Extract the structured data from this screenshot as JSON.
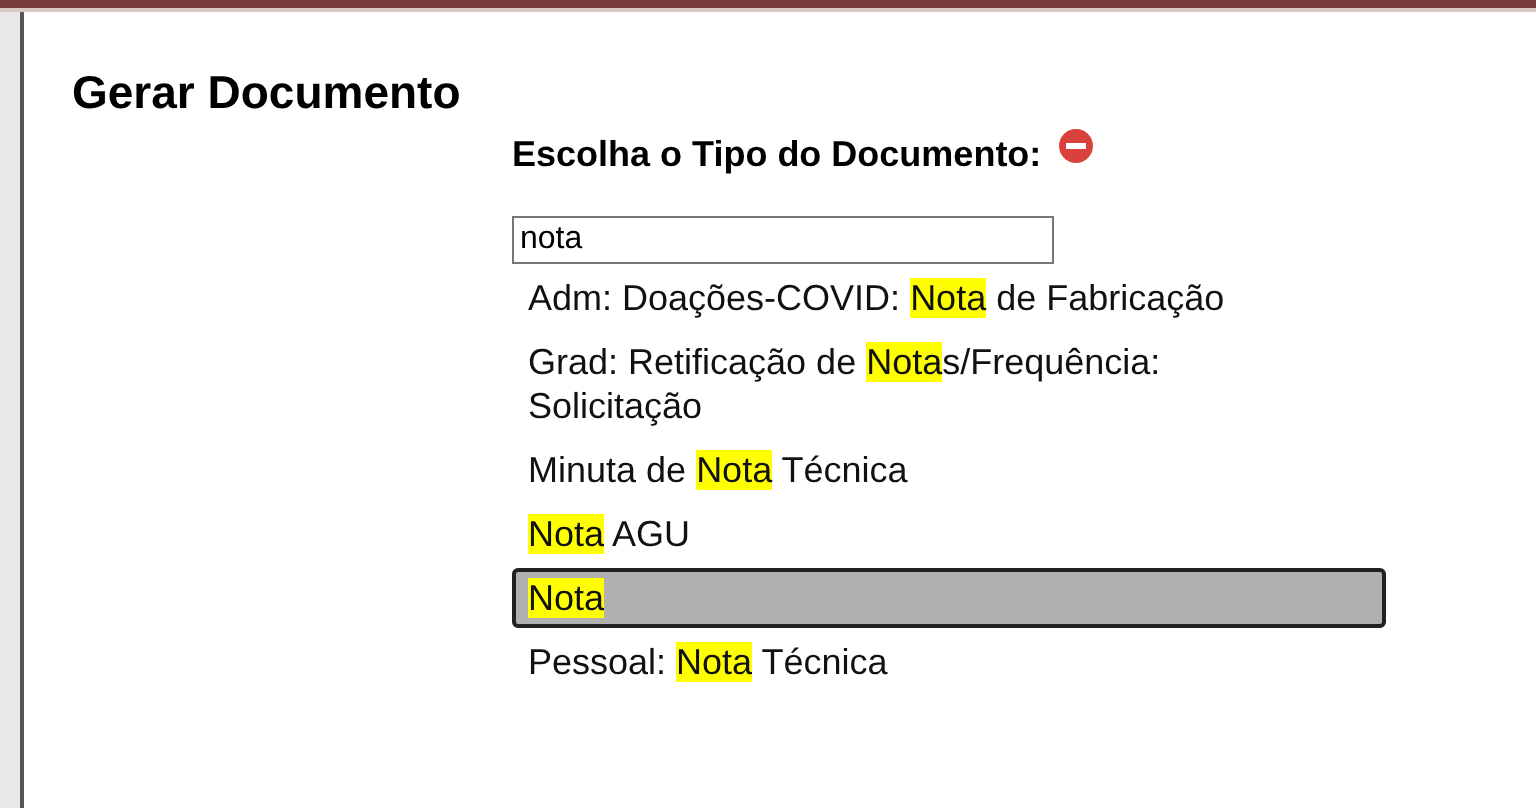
{
  "title": "Gerar Documento",
  "heading": "Escolha o Tipo do Documento:",
  "search": {
    "value": "nota"
  },
  "items": [
    {
      "selected": false,
      "parts": [
        {
          "text": "Adm: Doações-COVID: ",
          "highlighted": false
        },
        {
          "text": "Nota",
          "highlighted": true
        },
        {
          "text": " de Fabricação",
          "highlighted": false
        }
      ]
    },
    {
      "selected": false,
      "parts": [
        {
          "text": "Grad: Retificação de ",
          "highlighted": false
        },
        {
          "text": "Nota",
          "highlighted": true
        },
        {
          "text": "s/Frequência: Solicitação",
          "highlighted": false
        }
      ]
    },
    {
      "selected": false,
      "parts": [
        {
          "text": "Minuta de ",
          "highlighted": false
        },
        {
          "text": "Nota",
          "highlighted": true
        },
        {
          "text": " Técnica",
          "highlighted": false
        }
      ]
    },
    {
      "selected": false,
      "parts": [
        {
          "text": "Nota",
          "highlighted": true
        },
        {
          "text": " AGU",
          "highlighted": false
        }
      ]
    },
    {
      "selected": true,
      "parts": [
        {
          "text": "Nota",
          "highlighted": true
        }
      ]
    },
    {
      "selected": false,
      "parts": [
        {
          "text": "Pessoal: ",
          "highlighted": false
        },
        {
          "text": "Nota",
          "highlighted": true
        },
        {
          "text": " Técnica",
          "highlighted": false
        }
      ]
    }
  ]
}
